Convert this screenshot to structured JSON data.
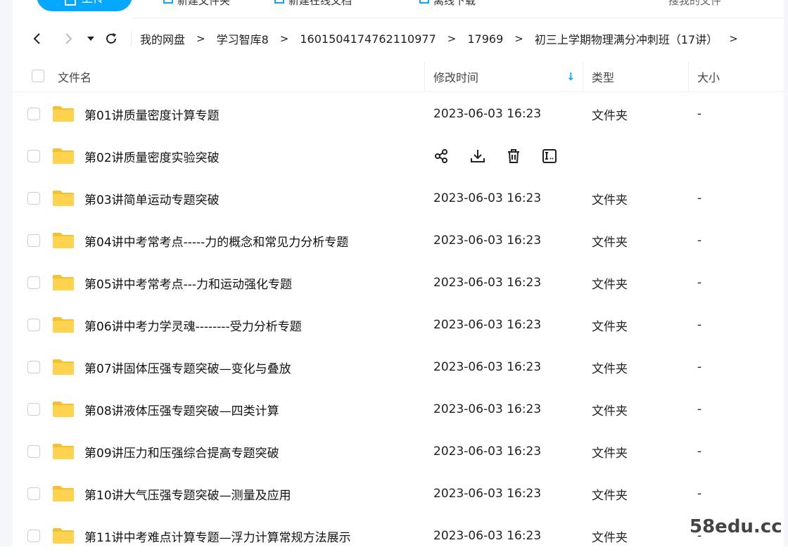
{
  "toolbar": {
    "upload_label": "上传",
    "item1": "新建文件夹",
    "item2": "新建在线文档",
    "item3": "离线下载",
    "right_text": "搜我的文件"
  },
  "breadcrumb": {
    "back": "‹",
    "forward": "›",
    "dropdown": "▾",
    "refresh": "⟳",
    "items": [
      "我的网盘",
      "学习智库8",
      "1601504174762110977",
      "17969",
      "初三上学期物理满分冲刺班（17讲）"
    ],
    "separator": ">"
  },
  "table": {
    "headers": {
      "name": "文件名",
      "time": "修改时间",
      "type": "类型",
      "size": "大小"
    },
    "sort_arrow": "↓",
    "rows": [
      {
        "name": "第01讲质量密度计算专题",
        "time": "2023-06-03 16:23",
        "type": "文件夹",
        "size": "-"
      },
      {
        "name": "第02讲质量密度实验突破",
        "time": "",
        "type": "",
        "size": "",
        "hover": true
      },
      {
        "name": "第03讲简单运动专题突破",
        "time": "2023-06-03 16:23",
        "type": "文件夹",
        "size": "-"
      },
      {
        "name": "第04讲中考常考点-----力的概念和常见力分析专题",
        "time": "2023-06-03 16:23",
        "type": "文件夹",
        "size": "-"
      },
      {
        "name": "第05讲中考常考点---力和运动强化专题",
        "time": "2023-06-03 16:23",
        "type": "文件夹",
        "size": "-"
      },
      {
        "name": "第06讲中考力学灵魂--------受力分析专题",
        "time": "2023-06-03 16:23",
        "type": "文件夹",
        "size": "-"
      },
      {
        "name": "第07讲固体压强专题突破—变化与叠放",
        "time": "2023-06-03 16:23",
        "type": "文件夹",
        "size": "-"
      },
      {
        "name": "第08讲液体压强专题突破—四类计算",
        "time": "2023-06-03 16:23",
        "type": "文件夹",
        "size": "-"
      },
      {
        "name": "第09讲压力和压强综合提高专题突破",
        "time": "2023-06-03 16:23",
        "type": "文件夹",
        "size": "-"
      },
      {
        "name": "第10讲大气压强专题突破—测量及应用",
        "time": "2023-06-03 16:23",
        "type": "文件夹",
        "size": "-"
      },
      {
        "name": "第11讲中考难点计算专题—浮力计算常规方法展示",
        "time": "2023-06-03 16:23",
        "type": "文件夹",
        "size": "-"
      }
    ],
    "hover_actions": [
      "share-icon",
      "download-icon",
      "delete-icon",
      "rename-icon"
    ]
  },
  "colors": {
    "accent": "#06a7ff",
    "folder": "#ffd34f",
    "folder_dark": "#f5c02e"
  },
  "watermark": "58edu.cc"
}
